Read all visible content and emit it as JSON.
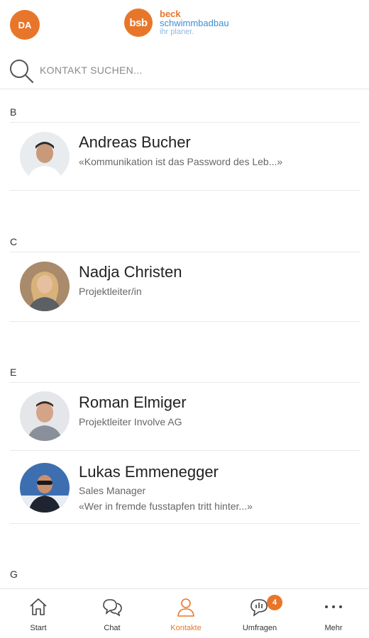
{
  "header": {
    "user_initials": "DA",
    "logo": {
      "mark": "bsb",
      "line1": "beck",
      "line2": "schwimmbadbau",
      "line3": "ihr planer."
    }
  },
  "search": {
    "placeholder": "KONTAKT SUCHEN...",
    "value": ""
  },
  "sections": [
    {
      "letter": "B",
      "contacts": [
        {
          "name": "Andreas Bucher",
          "lines": [
            "«Kommunikation ist das Password des Leb...»"
          ]
        }
      ]
    },
    {
      "letter": "C",
      "contacts": [
        {
          "name": "Nadja Christen",
          "lines": [
            "Projektleiter/in"
          ]
        }
      ]
    },
    {
      "letter": "E",
      "contacts": [
        {
          "name": "Roman Elmiger",
          "lines": [
            "Projektleiter Involve AG"
          ]
        },
        {
          "name": "Lukas Emmenegger",
          "lines": [
            "Sales Manager",
            "«Wer in fremde fusstapfen tritt hinter...»"
          ]
        }
      ]
    },
    {
      "letter": "G",
      "contacts": []
    }
  ],
  "tabs": [
    {
      "label": "Start",
      "icon": "home-icon"
    },
    {
      "label": "Chat",
      "icon": "chat-icon"
    },
    {
      "label": "Kontakte",
      "icon": "contacts-icon",
      "active": true
    },
    {
      "label": "Umfragen",
      "icon": "survey-icon",
      "badge": "4"
    },
    {
      "label": "Mehr",
      "icon": "more-icon"
    }
  ],
  "colors": {
    "accent": "#e8762a",
    "brand_blue": "#3c8fd1"
  }
}
